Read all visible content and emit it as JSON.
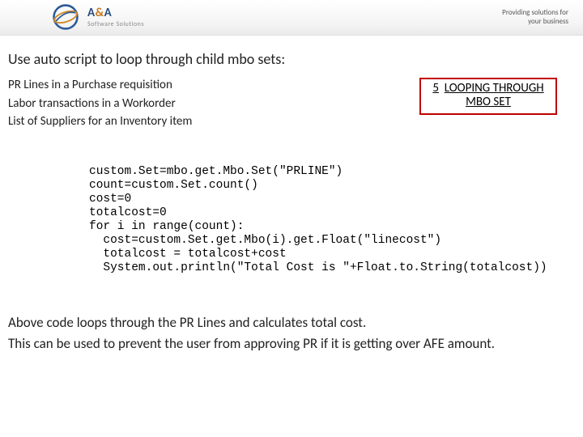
{
  "header": {
    "brand_prefix": "A",
    "brand_amp": "&",
    "brand_suffix": "A",
    "brand_sub": "Software Solutions",
    "tagline_l1": "Providing solutions for",
    "tagline_l2": "your business"
  },
  "content": {
    "intro": "Use auto script to loop through child mbo sets:",
    "examples": {
      "l1": "PR Lines in a Purchase requisition",
      "l2": "Labor transactions in a Workorder",
      "l3": "List of Suppliers for an Inventory item"
    },
    "callout": {
      "num": "5",
      "top": "LOOPING THROUGH",
      "bottom": "MBO SET"
    },
    "code": "custom.Set=mbo.get.Mbo.Set(\"PRLINE\")\ncount=custom.Set.count()\ncost=0\ntotalcost=0\nfor i in range(count):\n  cost=custom.Set.get.Mbo(i).get.Float(\"linecost\")\n  totalcost = totalcost+cost\n  System.out.println(\"Total Cost is \"+Float.to.String(totalcost))",
    "footer": {
      "l1": "Above code loops through the PR Lines and calculates total cost.",
      "l2": "This can be used to prevent the user from approving PR if it is getting over AFE amount."
    }
  }
}
